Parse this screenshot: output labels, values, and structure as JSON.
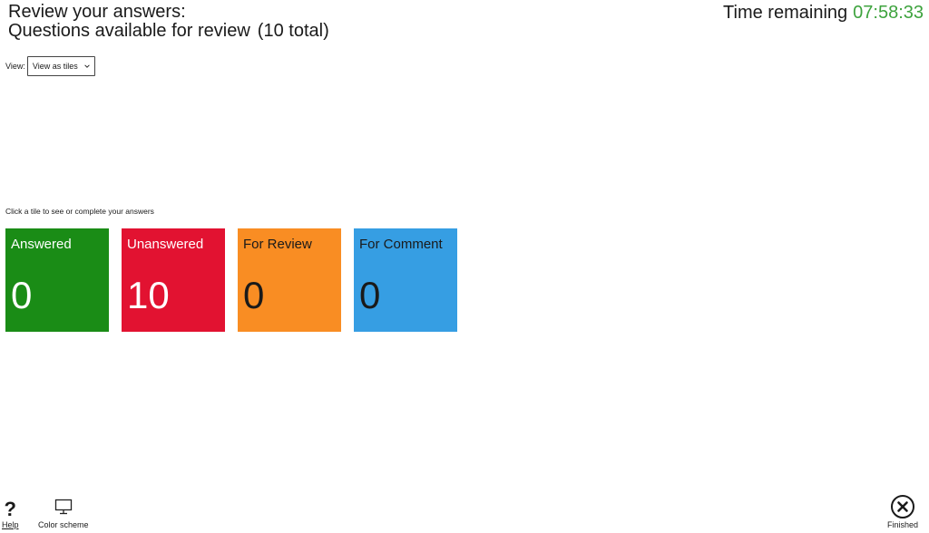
{
  "header": {
    "title": "Review your answers:",
    "subtitle": "Questions available for review",
    "total": "(10 total)"
  },
  "timer": {
    "label": "Time remaining",
    "value": "07:58:33"
  },
  "view": {
    "label": "View:",
    "selected": "View as tiles"
  },
  "instruction": "Click a tile to see or complete your answers",
  "tiles": [
    {
      "label": "Answered",
      "count": "0",
      "color": "#1a8c16"
    },
    {
      "label": "Unanswered",
      "count": "10",
      "color": "#e21231"
    },
    {
      "label": "For Review",
      "count": "0",
      "color": "#f98d23"
    },
    {
      "label": "For Comment",
      "count": "0",
      "color": "#369ee3"
    }
  ],
  "footer": {
    "help_glyph": "?",
    "help_label": "Help",
    "color_scheme_label": "Color scheme",
    "finished_label": "Finished"
  },
  "icons": [
    "help-icon",
    "monitor-icon",
    "close-circle-icon",
    "chevron-down-icon"
  ]
}
